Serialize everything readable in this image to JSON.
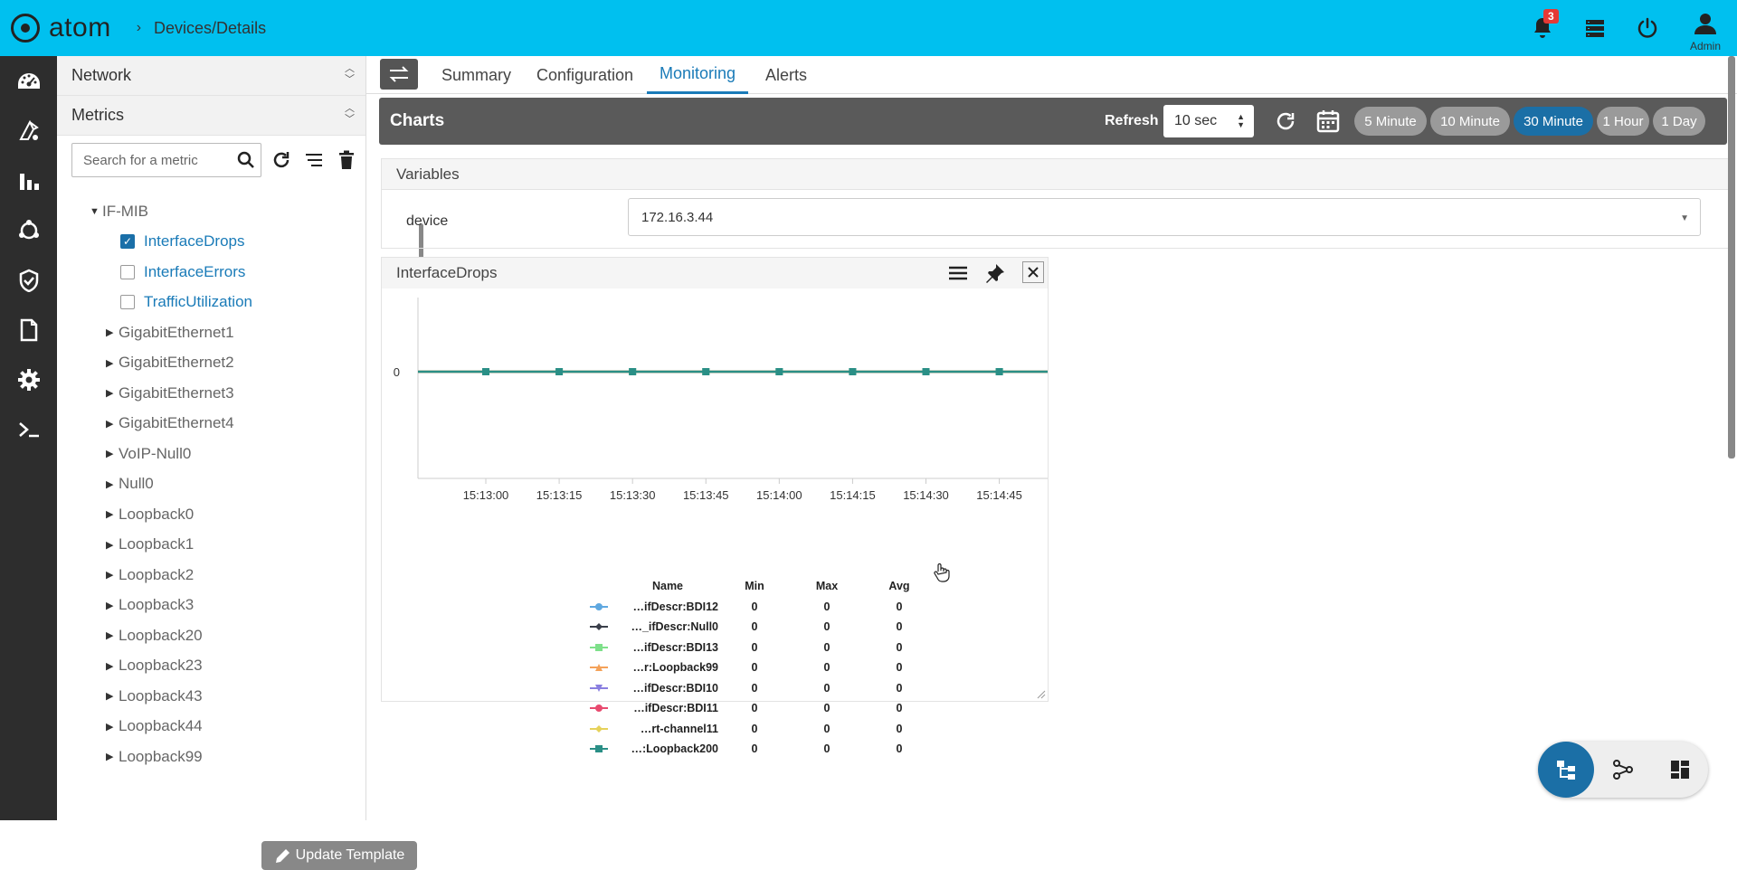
{
  "header": {
    "brand": "atom",
    "breadcrumb_sep": "›",
    "breadcrumb": "Devices/Details",
    "notification_count": "3",
    "user_label": "Admin"
  },
  "sidebar": {
    "sections": [
      {
        "label": "Network"
      },
      {
        "label": "Metrics"
      }
    ],
    "search_placeholder": "Search for a metric",
    "tree": {
      "root": "IF-MIB",
      "leaves": [
        {
          "label": "InterfaceDrops",
          "checked": true
        },
        {
          "label": "InterfaceErrors",
          "checked": false
        },
        {
          "label": "TrafficUtilization",
          "checked": false
        }
      ],
      "groups": [
        "GigabitEthernet1",
        "GigabitEthernet2",
        "GigabitEthernet3",
        "GigabitEthernet4",
        "VoIP-Null0",
        "Null0",
        "Loopback0",
        "Loopback1",
        "Loopback2",
        "Loopback3",
        "Loopback20",
        "Loopback23",
        "Loopback43",
        "Loopback44",
        "Loopback99"
      ]
    },
    "update_button": "Update Template"
  },
  "tabs": [
    "Summary",
    "Configuration",
    "Monitoring",
    "Alerts"
  ],
  "active_tab": "Monitoring",
  "charts_bar": {
    "title": "Charts",
    "refresh_label": "Refresh",
    "refresh_value": "10 sec",
    "ranges": [
      "5 Minute",
      "10 Minute",
      "30 Minute",
      "1 Hour",
      "1 Day"
    ],
    "active_range": "30 Minute"
  },
  "variables": {
    "title": "Variables",
    "device_label": "device",
    "device_value": "172.16.3.44"
  },
  "panel": {
    "title": "InterfaceDrops"
  },
  "chart_data": {
    "type": "line",
    "title": "InterfaceDrops",
    "x": [
      "15:13:00",
      "15:13:15",
      "15:13:30",
      "15:13:45",
      "15:14:00",
      "15:14:15",
      "15:14:30",
      "15:14:45"
    ],
    "y_ticks": [
      "0"
    ],
    "series": [
      {
        "name": "…ifDescr:BDI12",
        "color": "#5fa8e0",
        "marker": "circle",
        "values": [
          0,
          0,
          0,
          0,
          0,
          0,
          0,
          0
        ]
      },
      {
        "name": "…_ifDescr:Null0",
        "color": "#3a3f4a",
        "marker": "diamond",
        "values": [
          0,
          0,
          0,
          0,
          0,
          0,
          0,
          0
        ]
      },
      {
        "name": "…ifDescr:BDI13",
        "color": "#7ee08a",
        "marker": "square",
        "values": [
          0,
          0,
          0,
          0,
          0,
          0,
          0,
          0
        ]
      },
      {
        "name": "…r:Loopback99",
        "color": "#f4a259",
        "marker": "triangle",
        "values": [
          0,
          0,
          0,
          0,
          0,
          0,
          0,
          0
        ]
      },
      {
        "name": "…ifDescr:BDI10",
        "color": "#8a7fe0",
        "marker": "triangle-down",
        "values": [
          0,
          0,
          0,
          0,
          0,
          0,
          0,
          0
        ]
      },
      {
        "name": "…ifDescr:BDI11",
        "color": "#e84a6f",
        "marker": "circle",
        "values": [
          0,
          0,
          0,
          0,
          0,
          0,
          0,
          0
        ]
      },
      {
        "name": "…rt-channel11",
        "color": "#e6d25a",
        "marker": "diamond",
        "values": [
          0,
          0,
          0,
          0,
          0,
          0,
          0,
          0
        ]
      },
      {
        "name": "…:Loopback200",
        "color": "#2a8f86",
        "marker": "square",
        "values": [
          0,
          0,
          0,
          0,
          0,
          0,
          0,
          0
        ]
      }
    ],
    "legend_headers": [
      "Name",
      "Min",
      "Max",
      "Avg"
    ],
    "legend_rows": [
      {
        "name": "…ifDescr:BDI12",
        "min": "0",
        "max": "0",
        "avg": "0"
      },
      {
        "name": "…_ifDescr:Null0",
        "min": "0",
        "max": "0",
        "avg": "0"
      },
      {
        "name": "…ifDescr:BDI13",
        "min": "0",
        "max": "0",
        "avg": "0"
      },
      {
        "name": "…r:Loopback99",
        "min": "0",
        "max": "0",
        "avg": "0"
      },
      {
        "name": "…ifDescr:BDI10",
        "min": "0",
        "max": "0",
        "avg": "0"
      },
      {
        "name": "…ifDescr:BDI11",
        "min": "0",
        "max": "0",
        "avg": "0"
      },
      {
        "name": "…rt-channel11",
        "min": "0",
        "max": "0",
        "avg": "0"
      },
      {
        "name": "…:Loopback200",
        "min": "0",
        "max": "0",
        "avg": "0"
      }
    ]
  }
}
